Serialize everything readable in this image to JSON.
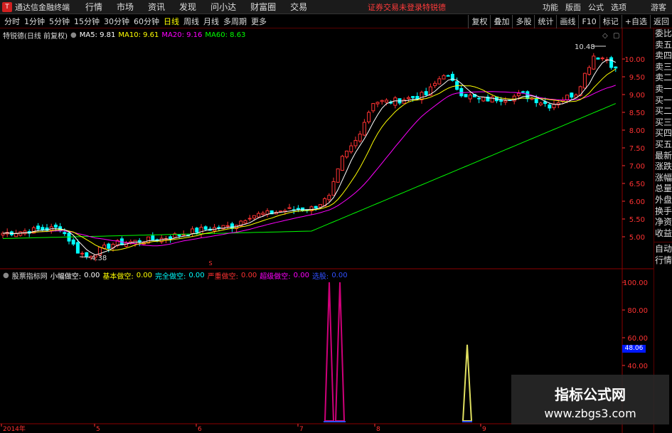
{
  "app": {
    "name": "通达信金融终端",
    "logo_text": "T"
  },
  "menu": [
    "行情",
    "市场",
    "资讯",
    "发现",
    "问小达",
    "财富圈",
    "交易"
  ],
  "login": {
    "status": "证券交易未登录",
    "stock": "特锐德"
  },
  "right_menu": [
    "功能",
    "版面",
    "公式",
    "选项"
  ],
  "guest_label": "游客",
  "periods": [
    {
      "label": "分时",
      "active": false
    },
    {
      "label": "1分钟",
      "active": false
    },
    {
      "label": "5分钟",
      "active": false
    },
    {
      "label": "15分钟",
      "active": false
    },
    {
      "label": "30分钟",
      "active": false
    },
    {
      "label": "60分钟",
      "active": false
    },
    {
      "label": "日线",
      "active": true
    },
    {
      "label": "周线",
      "active": false
    },
    {
      "label": "月线",
      "active": false
    },
    {
      "label": "多周期",
      "active": false
    },
    {
      "label": "更多",
      "active": false
    }
  ],
  "toolbar_right": [
    "复权",
    "叠加",
    "多股",
    "统计",
    "画线",
    "F10",
    "标记",
    "+自选",
    "返回"
  ],
  "ma_legend": {
    "title": "特锐德(日线 前复权)",
    "ma5": "MA5: 9.81",
    "ma10": "MA10: 9.61",
    "ma20": "MA20: 9.16",
    "ma60": "MA60: 8.63"
  },
  "colors": {
    "ma5": "#ffffff",
    "ma10": "#ffff00",
    "ma20": "#ff00ff",
    "ma60": "#00ff00",
    "up": "#ff3232",
    "down": "#00ffff",
    "grid": "#8b0000",
    "axis_text": "#ff3232"
  },
  "price_axis": [
    "10.00",
    "9.50",
    "9.00",
    "8.50",
    "8.00",
    "7.50",
    "7.00",
    "6.50",
    "6.00",
    "5.50",
    "5.00"
  ],
  "annotations": {
    "high": "10.48",
    "low": "4.38",
    "s_marker": "S"
  },
  "sidebar_tabs": [
    "委比",
    "卖五",
    "卖四",
    "卖三",
    "卖二",
    "卖一",
    "买一",
    "买二",
    "买三",
    "买四",
    "买五",
    "最新",
    "涨跌",
    "涨幅",
    "总量",
    "外盘",
    "换手",
    "净资",
    "收益"
  ],
  "sidebar_bottom": [
    "自动",
    "行情"
  ],
  "indicator_legend": {
    "name": "股票指标网",
    "items": [
      {
        "label": "小幅做空:",
        "value": "0.00"
      },
      {
        "label": "基本做空:",
        "value": "0.00"
      },
      {
        "label": "完全做空:",
        "value": "0.00"
      },
      {
        "label": "严重做空:",
        "value": "0.00"
      },
      {
        "label": "超级做空:",
        "value": "0.00"
      },
      {
        "label": "选股:",
        "value": "0.00"
      }
    ]
  },
  "indicator_axis": [
    "100.00",
    "80.00",
    "60.00",
    "40.00"
  ],
  "indicator_value_box": "48.06",
  "x_axis": [
    "2014年",
    "5",
    "6",
    "7",
    "8",
    "9"
  ],
  "watermark": {
    "title": "指标公式网",
    "url": "www.zbgs3.com"
  }
}
